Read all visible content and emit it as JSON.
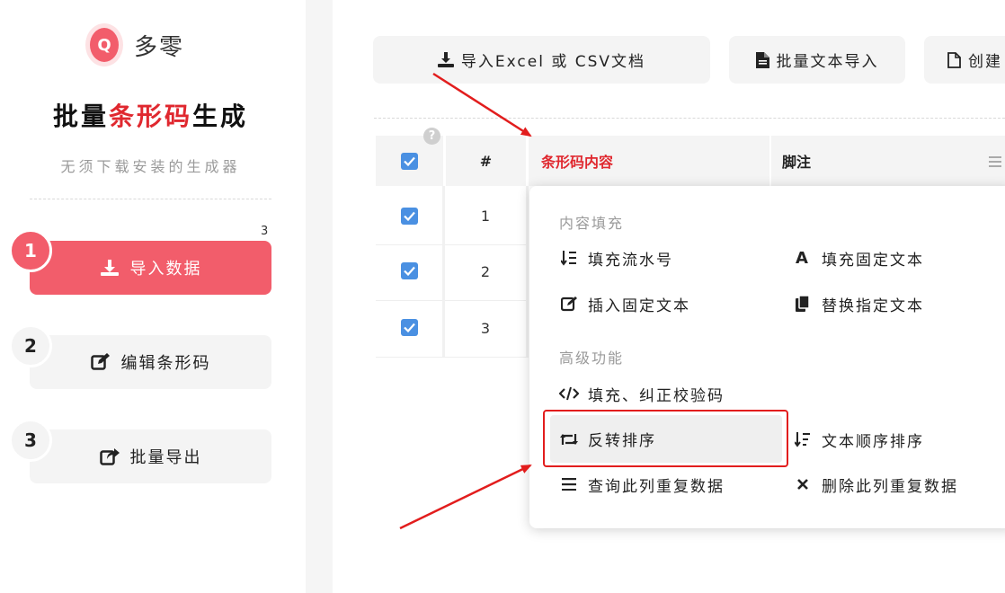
{
  "brand": {
    "logo_letter": "Q",
    "name": "多零"
  },
  "sidebar": {
    "title_prefix": "批量",
    "title_highlight": "条形码",
    "title_suffix": "生成",
    "subtitle": "无须下载安装的生成器",
    "step_count_badge": "3",
    "steps": [
      {
        "num": "1",
        "label": "导入数据",
        "icon": "download-icon",
        "active": true
      },
      {
        "num": "2",
        "label": "编辑条形码",
        "icon": "edit-icon",
        "active": false
      },
      {
        "num": "3",
        "label": "批量导出",
        "icon": "export-icon",
        "active": false
      }
    ]
  },
  "toolbar": {
    "import_excel": "导入Excel 或 CSV文档",
    "batch_text": "批量文本导入",
    "create": "创建"
  },
  "table": {
    "help_glyph": "?",
    "headers": {
      "index": "#",
      "content": "条形码内容",
      "note": "脚注"
    },
    "rows": [
      {
        "index": "1"
      },
      {
        "index": "2"
      },
      {
        "index": "3"
      }
    ]
  },
  "menu": {
    "section_fill": "内容填充",
    "section_advanced": "高级功能",
    "items": {
      "fill_serial": "填充流水号",
      "fill_fixed": "填充固定文本",
      "insert_fixed": "插入固定文本",
      "replace_text": "替换指定文本",
      "fix_checksum": "填充、纠正校验码",
      "reverse_sort": "反转排序",
      "text_sort": "文本顺序排序",
      "find_duplicates": "查询此列重复数据",
      "delete_duplicates": "删除此列重复数据"
    }
  },
  "colors": {
    "accent": "#f25d6b",
    "highlight_red": "#e0282f",
    "checkbox_blue": "#4a90e2"
  }
}
